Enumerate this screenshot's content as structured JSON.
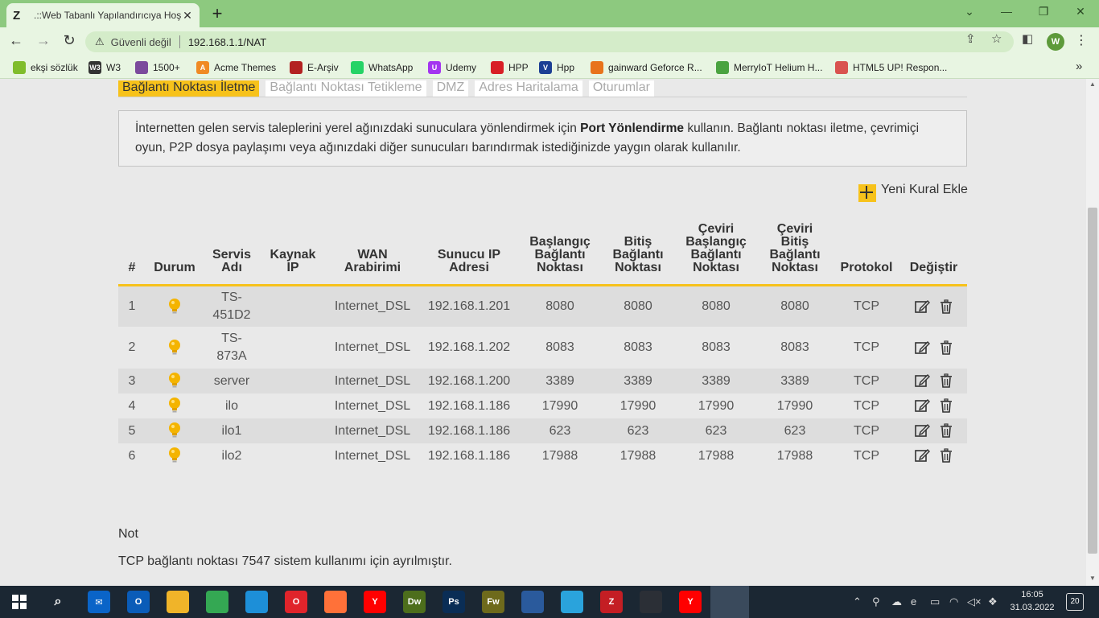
{
  "browser": {
    "tab_title": ".::Web Tabanlı Yapılandırıcıya Hoş",
    "tab_favicon": "Z",
    "security_label": "Güvenli değil",
    "url": "192.168.1.1/NAT",
    "profile_initial": "W"
  },
  "bookmarks": [
    {
      "label": "ekşi sözlük",
      "icon": "leaf-icon",
      "color": "#80bd2c",
      "glyph": ""
    },
    {
      "label": "W3",
      "icon": "w3-icon",
      "color": "#333333",
      "glyph": "W3"
    },
    {
      "label": "1500+",
      "icon": "colorlib-icon",
      "color": "#7b4a9c",
      "glyph": ""
    },
    {
      "label": "Acme Themes",
      "icon": "acme-icon",
      "color": "#f08a24",
      "glyph": "A"
    },
    {
      "label": "E-Arşiv",
      "icon": "earsiv-icon",
      "color": "#b32222",
      "glyph": ""
    },
    {
      "label": "WhatsApp",
      "icon": "whatsapp-icon",
      "color": "#25d366",
      "glyph": ""
    },
    {
      "label": "Udemy",
      "icon": "udemy-icon",
      "color": "#a435f0",
      "glyph": "U"
    },
    {
      "label": "HPP",
      "icon": "hpp-icon",
      "color": "#d81f26",
      "glyph": ""
    },
    {
      "label": "Hpp",
      "icon": "v-icon",
      "color": "#1c3f94",
      "glyph": "V"
    },
    {
      "label": "gainward Geforce R...",
      "icon": "gainward-icon",
      "color": "#e8731c",
      "glyph": ""
    },
    {
      "label": "MerryIoT Helium H...",
      "icon": "merryiot-icon",
      "color": "#4aa340",
      "glyph": ""
    },
    {
      "label": "HTML5 UP! Respon...",
      "icon": "html5up-icon",
      "color": "#d9534f",
      "glyph": ""
    }
  ],
  "subtabs": [
    {
      "label": "Bağlantı Noktası İletme",
      "active": true
    },
    {
      "label": "Bağlantı Noktası Tetikleme",
      "active": false
    },
    {
      "label": "DMZ",
      "active": false
    },
    {
      "label": "Adres Haritalama",
      "active": false
    },
    {
      "label": "Oturumlar",
      "active": false
    }
  ],
  "info": {
    "prefix": "İnternetten gelen servis taleplerini yerel ağınızdaki sunuculara yönlendirmek için ",
    "bold": "Port Yönlendirme",
    "suffix": " kullanın. Bağlantı noktası iletme, çevrimiçi oyun, P2P dosya paylaşımı veya ağınızdaki diğer sunucuları barındırmak istediğinizde yaygın olarak kullanılır."
  },
  "add_rule_label": "Yeni Kural Ekle",
  "table": {
    "headers": [
      [
        "#"
      ],
      [
        "Durum"
      ],
      [
        "Servis",
        "Adı"
      ],
      [
        "Kaynak",
        "IP"
      ],
      [
        "WAN",
        "Arabirimi"
      ],
      [
        "Sunucu IP",
        "Adresi"
      ],
      [
        "Başlangıç",
        "Bağlantı",
        "Noktası"
      ],
      [
        "Bitiş",
        "Bağlantı",
        "Noktası"
      ],
      [
        "Çeviri",
        "Başlangıç",
        "Bağlantı",
        "Noktası"
      ],
      [
        "Çeviri",
        "Bitiş",
        "Bağlantı",
        "Noktası"
      ],
      [
        "Protokol"
      ],
      [
        "Değiştir"
      ]
    ],
    "rows": [
      {
        "num": "1",
        "service": [
          "TS-",
          "451D2"
        ],
        "source_ip": "",
        "wan": "Internet_DSL",
        "server_ip": "192.168.1.201",
        "start": "8080",
        "end": "8080",
        "tstart": "8080",
        "tend": "8080",
        "protocol": "TCP"
      },
      {
        "num": "2",
        "service": [
          "TS-",
          "873A"
        ],
        "source_ip": "",
        "wan": "Internet_DSL",
        "server_ip": "192.168.1.202",
        "start": "8083",
        "end": "8083",
        "tstart": "8083",
        "tend": "8083",
        "protocol": "TCP"
      },
      {
        "num": "3",
        "service": [
          "server"
        ],
        "source_ip": "",
        "wan": "Internet_DSL",
        "server_ip": "192.168.1.200",
        "start": "3389",
        "end": "3389",
        "tstart": "3389",
        "tend": "3389",
        "protocol": "TCP"
      },
      {
        "num": "4",
        "service": [
          "ilo"
        ],
        "source_ip": "",
        "wan": "Internet_DSL",
        "server_ip": "192.168.1.186",
        "start": "17990",
        "end": "17990",
        "tstart": "17990",
        "tend": "17990",
        "protocol": "TCP"
      },
      {
        "num": "5",
        "service": [
          "ilo1"
        ],
        "source_ip": "",
        "wan": "Internet_DSL",
        "server_ip": "192.168.1.186",
        "start": "623",
        "end": "623",
        "tstart": "623",
        "tend": "623",
        "protocol": "TCP"
      },
      {
        "num": "6",
        "service": [
          "ilo2"
        ],
        "source_ip": "",
        "wan": "Internet_DSL",
        "server_ip": "192.168.1.186",
        "start": "17988",
        "end": "17988",
        "tstart": "17988",
        "tend": "17988",
        "protocol": "TCP"
      }
    ]
  },
  "note": {
    "title": "Not",
    "text": "TCP bağlantı noktası 7547 sistem kullanımı için ayrılmıştır."
  },
  "taskbar": {
    "apps": [
      {
        "name": "mail-icon",
        "color": "#0a64c8",
        "glyph": "✉"
      },
      {
        "name": "outlook-icon",
        "color": "#0a5cb8",
        "glyph": "O"
      },
      {
        "name": "file-explorer-icon",
        "color": "#f0b429",
        "glyph": ""
      },
      {
        "name": "chrome-icon",
        "color": "#34a853",
        "glyph": ""
      },
      {
        "name": "edge-icon",
        "color": "#1d8fd8",
        "glyph": ""
      },
      {
        "name": "opera-icon",
        "color": "#e0242b",
        "glyph": "O"
      },
      {
        "name": "firefox-icon",
        "color": "#ff7139",
        "glyph": ""
      },
      {
        "name": "yandex-icon",
        "color": "#ff0000",
        "glyph": "Y"
      },
      {
        "name": "dreamweaver-icon",
        "color": "#4d6e1c",
        "glyph": "Dw"
      },
      {
        "name": "photoshop-icon",
        "color": "#0a2d55",
        "glyph": "Ps"
      },
      {
        "name": "fireworks-icon",
        "color": "#6e6a1c",
        "glyph": "Fw"
      },
      {
        "name": "save-disk-icon",
        "color": "#2a5a9c",
        "glyph": ""
      },
      {
        "name": "telegram-icon",
        "color": "#2aa3dc",
        "glyph": ""
      },
      {
        "name": "filezilla-icon",
        "color": "#c41e24",
        "glyph": "Z"
      },
      {
        "name": "binance-icon",
        "color": "#2b2f36",
        "glyph": ""
      },
      {
        "name": "yandex-browser-icon",
        "color": "#ff0000",
        "glyph": "Y"
      }
    ],
    "time": "16:05",
    "date": "31.03.2022",
    "notifications": "20"
  }
}
